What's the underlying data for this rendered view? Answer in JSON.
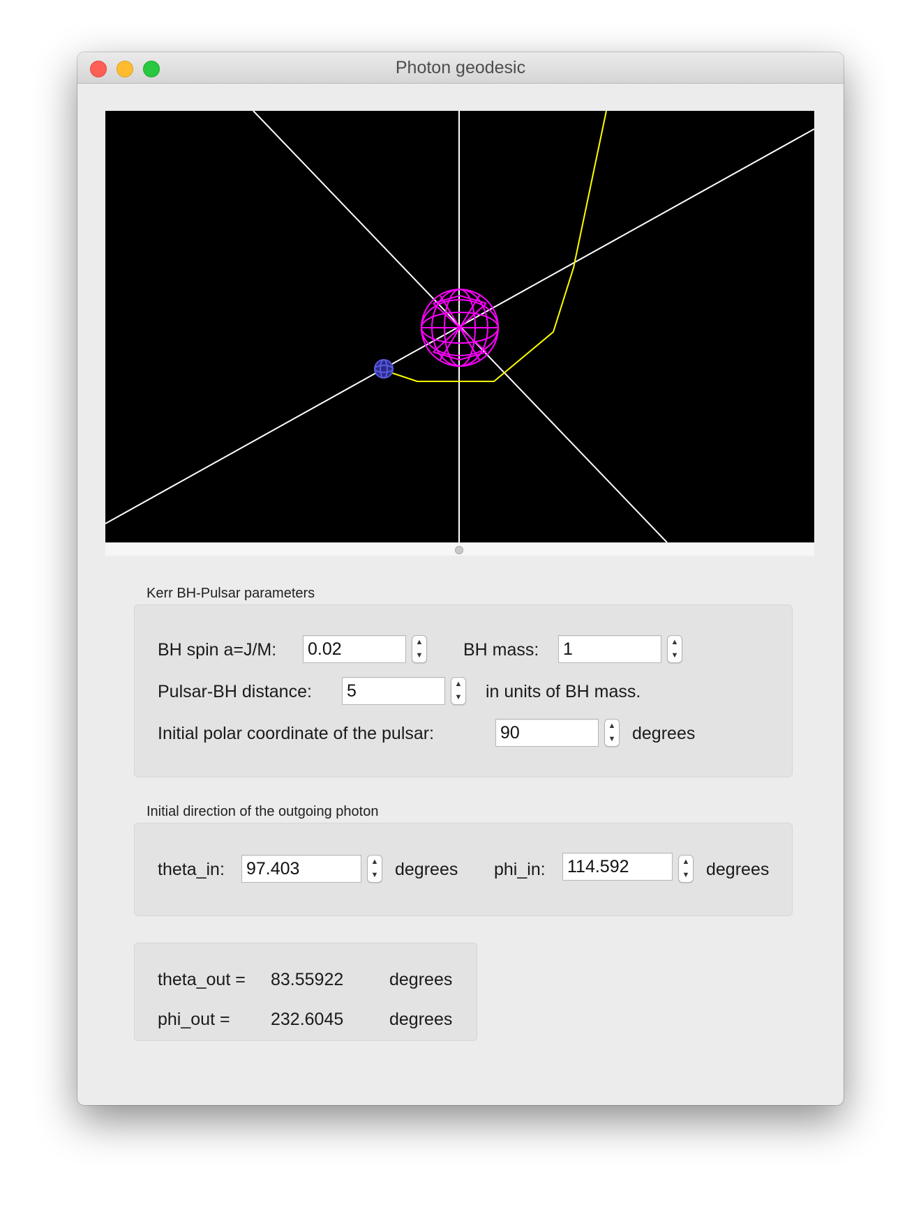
{
  "window": {
    "title": "Photon geodesic"
  },
  "viewport": {
    "background": "#000000",
    "axis_color": "#ffffff",
    "geodesic_color": "#ffff00",
    "black_hole_color": "#ff00ff",
    "pulsar_color": "#4a4ad8"
  },
  "kerr_group": {
    "label": "Kerr BH-Pulsar parameters",
    "spin_label": "BH spin a=J/M:",
    "spin_value": "0.02",
    "mass_label": "BH mass:",
    "mass_value": "1",
    "distance_label": "Pulsar-BH distance:",
    "distance_value": "5",
    "distance_unit": "in units of BH mass.",
    "polar_label": "Initial polar coordinate of the pulsar:",
    "polar_value": "90",
    "polar_unit": "degrees"
  },
  "direction_group": {
    "label": "Initial direction of the outgoing photon",
    "theta_label": "theta_in:",
    "theta_value": "97.403",
    "theta_unit": "degrees",
    "phi_label": "phi_in:",
    "phi_value": "114.592",
    "phi_unit": "degrees"
  },
  "output_group": {
    "theta_label": "theta_out =",
    "theta_value": "83.55922",
    "theta_unit": "degrees",
    "phi_label": "phi_out =",
    "phi_value": "232.6045",
    "phi_unit": "degrees"
  },
  "icons": {
    "spinner_up": "▲",
    "spinner_down": "▼"
  }
}
